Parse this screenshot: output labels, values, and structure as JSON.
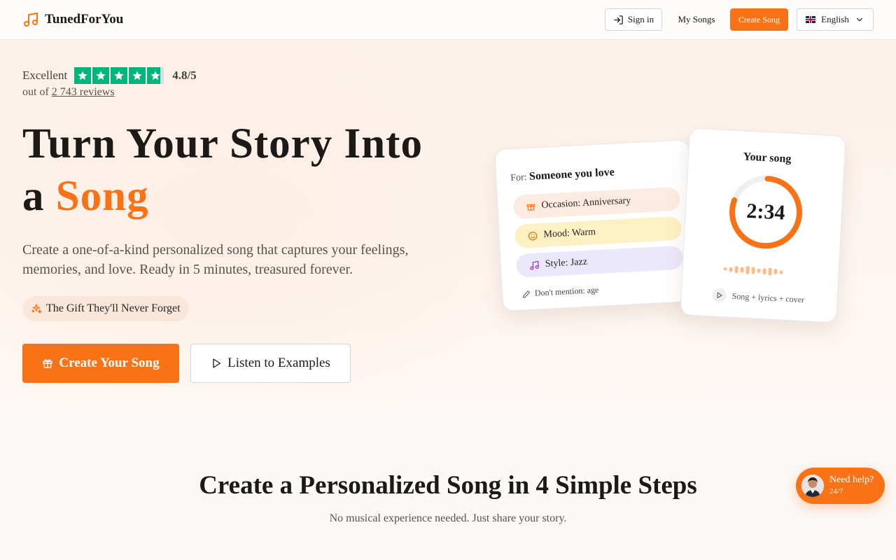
{
  "nav": {
    "brand": "TunedForYou",
    "signin": "Sign in",
    "my_songs": "My Songs",
    "create_song": "Create Song",
    "language": "English"
  },
  "hero": {
    "rating_word": "Excellent",
    "rating_score": "4.8/5",
    "reviews_prefix": "out of",
    "reviews_link": "2 743 reviews",
    "headline_line1": "Turn Your Story Into",
    "headline_a": "a",
    "headline_accent": "Song",
    "subtext": "Create a one-of-a-kind personalized song that captures your feelings, memories, and love. Ready in 5 minutes, treasured forever.",
    "pill": "The Gift They'll Never Forget",
    "cta_primary": "Create Your Song",
    "cta_secondary": "Listen to Examples"
  },
  "card_left": {
    "for_label": "For:",
    "for_value": "Someone you love",
    "occasion": "Occasion: Anniversary",
    "mood": "Mood: Warm",
    "style": "Style: Jazz",
    "dont_mention": "Don't mention: age"
  },
  "card_right": {
    "title": "Your song",
    "time": "2:34",
    "footer": "Song + lyrics + cover"
  },
  "steps": {
    "title": "Create a Personalized Song in 4 Simple Steps",
    "subtitle": "No musical experience needed. Just share your story."
  },
  "help": {
    "title": "Need help?",
    "sub": "24/7"
  },
  "colors": {
    "accent": "#f97316",
    "trustpilot_green": "#00b67a"
  }
}
